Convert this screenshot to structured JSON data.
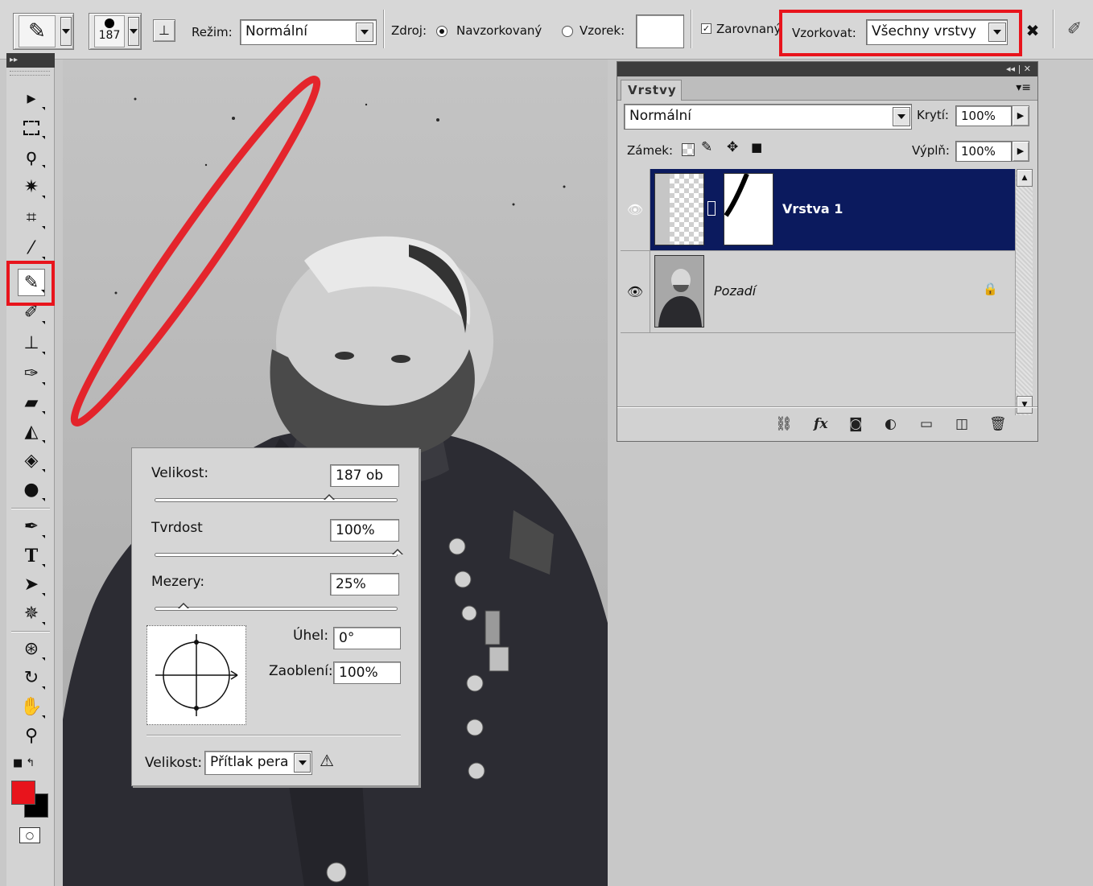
{
  "options_bar": {
    "brush_size": "187",
    "mode_label": "Režim:",
    "mode_value": "Normální",
    "source_label": "Zdroj:",
    "source_sampled": "Navzorkovaný",
    "source_pattern": "Vzorek:",
    "aligned_label": "Zarovnaný",
    "sample_label": "Vzorkovat:",
    "sample_value": "Všechny vrstvy"
  },
  "brush_popup": {
    "size_label": "Velikost:",
    "size_value": "187 ob",
    "size_fraction": 0.72,
    "hardness_label": "Tvrdost",
    "hardness_value": "100%",
    "hardness_fraction": 1.0,
    "spacing_label": "Mezery:",
    "spacing_value": "25%",
    "spacing_fraction": 0.12,
    "angle_label": "Úhel:",
    "angle_value": "0°",
    "roundness_label": "Zaoblení:",
    "roundness_value": "100%",
    "pen_size_label": "Velikost:",
    "pen_size_value": "Přítlak pera"
  },
  "layers_panel": {
    "tab_label": "Vrstvy",
    "blend_mode": "Normální",
    "opacity_label": "Krytí:",
    "opacity_value": "100%",
    "lock_label": "Zámek:",
    "fill_label": "Výplň:",
    "fill_value": "100%",
    "layers": [
      {
        "name": "Vrstva 1",
        "selected": true
      },
      {
        "name": "Pozadí",
        "selected": false,
        "locked": true
      }
    ],
    "footer_fx": "fx"
  },
  "toolbox": {
    "active_tool": "healing-brush",
    "foreground_color": "#e8141c",
    "background_color": "#000000"
  },
  "highlight_color": "#e8141c"
}
